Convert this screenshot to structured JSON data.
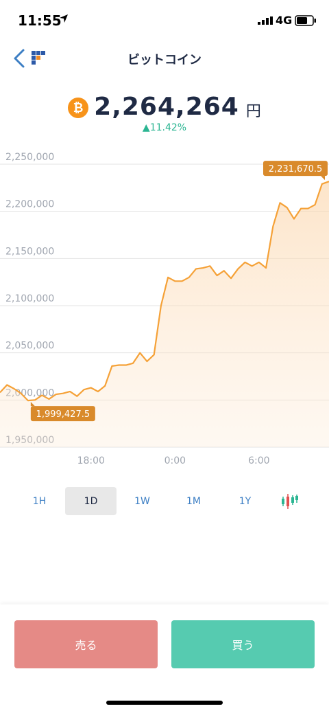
{
  "status_bar": {
    "time": "11:55",
    "network": "4G"
  },
  "nav": {
    "title": "ビットコイン"
  },
  "price": {
    "value": "2,264,264",
    "unit": "円",
    "change": "▲11.42%"
  },
  "periods": [
    {
      "label": "1H",
      "active": false
    },
    {
      "label": "1D",
      "active": true
    },
    {
      "label": "1W",
      "active": false
    },
    {
      "label": "1M",
      "active": false
    },
    {
      "label": "1Y",
      "active": false
    }
  ],
  "actions": {
    "sell_label": "売る",
    "buy_label": "買う"
  },
  "colors": {
    "line": "#f5a137",
    "up": "#2bb592",
    "label_bg": "#d98a2b",
    "sell": "#e58a86",
    "buy": "#56cbb0"
  },
  "chart_data": {
    "type": "area",
    "y_ticks": [
      "2,250,000",
      "2,200,000",
      "2,150,000",
      "2,100,000",
      "2,050,000",
      "2,000,000",
      "1,950,000"
    ],
    "ylim": [
      1950000,
      2250000
    ],
    "x_ticks": [
      {
        "label": "18:00",
        "x": 13.0
      },
      {
        "label": "0:00",
        "x": 25.0
      },
      {
        "label": "6:00",
        "x": 37.0
      }
    ],
    "max_label": "2,231,670.5",
    "min_label": "1,999,427.5",
    "max_point_index": 47,
    "min_point_index": 4,
    "series": [
      {
        "x": [
          0,
          1,
          2,
          3,
          4,
          5,
          6,
          7,
          8,
          9,
          10,
          11,
          12,
          13,
          14,
          15,
          16,
          17,
          18,
          19,
          20,
          21,
          22,
          23,
          24,
          25,
          26,
          27,
          28,
          29,
          30,
          31,
          32,
          33,
          34,
          35,
          36,
          37,
          38,
          39,
          40,
          41,
          42,
          43,
          44,
          45,
          46,
          47
        ],
        "values": [
          2008000,
          2016000,
          2012000,
          2007000,
          1999428,
          2000000,
          2005000,
          2001000,
          2006000,
          2007000,
          2009000,
          2004000,
          2011000,
          2013000,
          2009000,
          2015000,
          2036000,
          2037000,
          2037000,
          2039000,
          2050000,
          2041000,
          2048000,
          2100000,
          2130000,
          2126000,
          2126000,
          2130000,
          2139000,
          2140000,
          2142000,
          2132000,
          2137000,
          2129000,
          2139000,
          2146000,
          2142000,
          2146000,
          2140000,
          2184000,
          2209000,
          2204000,
          2192000,
          2203000,
          2203000,
          2207000,
          2229000,
          2231671
        ]
      }
    ]
  }
}
